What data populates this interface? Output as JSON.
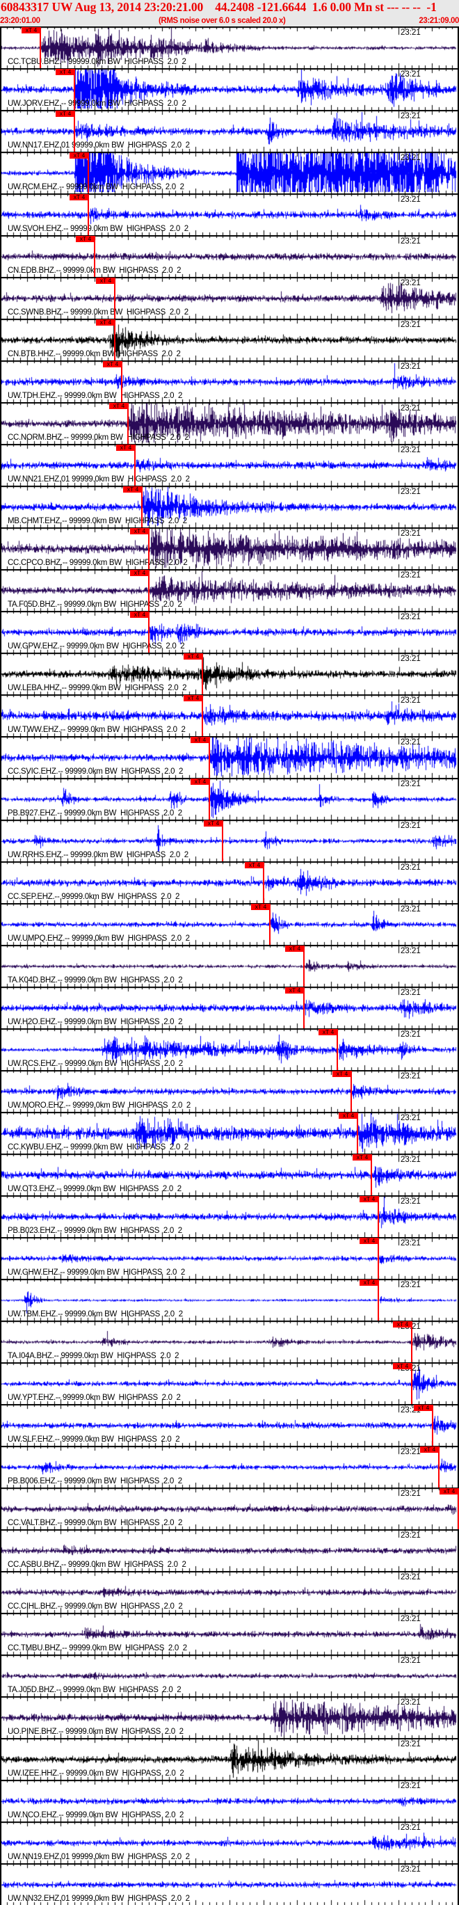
{
  "header": {
    "title": "60843317 UW Aug 13, 2014 23:20:21.00    44.2408 -121.6644  1.6 0.00 Mn st --- -- --  -1",
    "start_time": "23:20:01.00",
    "note": "(RMS noise over 6.0 s scaled 20.0 x)",
    "end_time": "23:21:09.00"
  },
  "axis": {
    "span_seconds": 68,
    "minute_label": "23:21",
    "minute_label_seconds": 59
  },
  "pick_label": "xT 4",
  "colors": {
    "ehz": "#0000ff",
    "bhz": "#2a0a58",
    "hhz": "#000000",
    "pick": "#ff0000",
    "header_text": "#ee0000",
    "header_bg": "#e8e8e8"
  },
  "traces": [
    {
      "label": "CC.TCBU.BHZ.-- 99999.0km BW  HIGHPASS  2.0  2",
      "color": "#2a0a58",
      "pick_s": 6.0
    },
    {
      "label": "UW.JORV.EHZ.-- 99999.0km BW  HIGHPASS  2.0  2",
      "color": "#0000ff",
      "pick_s": 11.0
    },
    {
      "label": "UW.NN17.EHZ.01 99999.0km BW  HIGHPASS  2.0  2",
      "color": "#0000ff",
      "pick_s": 11.0
    },
    {
      "label": "UW.RCM.EHZ.-- 99999.0km BW  HIGHPASS  2.0  2",
      "color": "#0000ff",
      "pick_s": 13.1
    },
    {
      "label": "UW.SVOH.EHZ.-- 99999.0km BW  HIGHPASS  2.0  2",
      "color": "#0000ff",
      "pick_s": 13.1
    },
    {
      "label": "CN.EDB.BHZ.-- 99999.0km BW  HIGHPASS  2.0  2",
      "color": "#2a0a58",
      "pick_s": 14.0
    },
    {
      "label": "CC.SWNB.BHZ.-- 99999.0km BW  HIGHPASS  2.0  2",
      "color": "#2a0a58",
      "pick_s": 17.0
    },
    {
      "label": "CN.BTB.HHZ.-- 99999.0km BW  HIGHPASS  2.0  2",
      "color": "#000000",
      "pick_s": 17.0
    },
    {
      "label": "UW.TDH.EHZ.-- 99999.0km BW  HIGHPASS  2.0  2",
      "color": "#0000ff",
      "pick_s": 18.0
    },
    {
      "label": "CC.NORM.BHZ.-- 99999.0km BW  HIGHPASS  2.0  2",
      "color": "#2a0a58",
      "pick_s": 19.0
    },
    {
      "label": "UW.NN21.EHZ.01 99999.0km BW  HIGHPASS  2.0  2",
      "color": "#0000ff",
      "pick_s": 20.0
    },
    {
      "label": "MB.CHMT.EHZ.-- 99999.0km BW  HIGHPASS  2.0  2",
      "color": "#0000ff",
      "pick_s": 21.0
    },
    {
      "label": "CC.CPCO.BHZ.-- 99999.0km BW  HIGHPASS  2.0  2",
      "color": "#2a0a58",
      "pick_s": 22.0
    },
    {
      "label": "TA.F05D.BHZ.-- 99999.0km BW  HIGHPASS  2.0  2",
      "color": "#2a0a58",
      "pick_s": 22.0
    },
    {
      "label": "UW.GPW.EHZ.-- 99999.0km BW  HIGHPASS  2.0  2",
      "color": "#0000ff",
      "pick_s": 22.0
    },
    {
      "label": "UW.LEBA.HHZ.-- 99999.0km BW  HIGHPASS  2.0  2",
      "color": "#000000",
      "pick_s": 30.0
    },
    {
      "label": "UW.TWW.EHZ.-- 99999.0km BW  HIGHPASS  2.0  2",
      "color": "#0000ff",
      "pick_s": 30.0
    },
    {
      "label": "CC.SVIC.EHZ.-- 99999.0km BW  HIGHPASS  2.0  2",
      "color": "#0000ff",
      "pick_s": 31.0
    },
    {
      "label": "PB.B927.EHZ.-- 99999.0km BW  HIGHPASS  2.0  2",
      "color": "#0000ff",
      "pick_s": 31.0
    },
    {
      "label": "UW.RRHS.EHZ.-- 99999.0km BW  HIGHPASS  2.0  2",
      "color": "#0000ff",
      "pick_s": 33.0
    },
    {
      "label": "CC.SEP.EHZ.-- 99999.0km BW  HIGHPASS  2.0  2",
      "color": "#0000ff",
      "pick_s": 39.0
    },
    {
      "label": "UW.UMPQ.EHZ.-- 99999.0km BW  HIGHPASS  2.0  2",
      "color": "#0000ff",
      "pick_s": 40.0
    },
    {
      "label": "TA.K04D.BHZ.-- 99999.0km BW  HIGHPASS  2.0  2",
      "color": "#2a0a58",
      "pick_s": 45.0
    },
    {
      "label": "UW.H2O.EHZ.-- 99999.0km BW  HIGHPASS  2.0  2",
      "color": "#0000ff",
      "pick_s": 45.0
    },
    {
      "label": "UW.RCS.EHZ.-- 99999.0km BW  HIGHPASS  2.0  2",
      "color": "#0000ff",
      "pick_s": 50.0
    },
    {
      "label": "UW.MORO.EHZ.-- 99999.0km BW  HIGHPASS  2.0  2",
      "color": "#0000ff",
      "pick_s": 52.0
    },
    {
      "label": "CC.KWBU.EHZ.-- 99999.0km BW  HIGHPASS  2.0  2",
      "color": "#0000ff",
      "pick_s": 53.0
    },
    {
      "label": "UW.OT3.EHZ.-- 99999.0km BW  HIGHPASS  2.0  2",
      "color": "#0000ff",
      "pick_s": 55.0
    },
    {
      "label": "PB.B023.EHZ.-- 99999.0km BW  HIGHPASS  2.0  2",
      "color": "#0000ff",
      "pick_s": 56.0
    },
    {
      "label": "UW.GHW.EHZ.-- 99999.0km BW  HIGHPASS  2.0  2",
      "color": "#0000ff",
      "pick_s": 56.0
    },
    {
      "label": "UW.TBM.EHZ.-- 99999.0km BW  HIGHPASS  2.0  2",
      "color": "#0000ff",
      "pick_s": 56.0
    },
    {
      "label": "TA.I04A.BHZ.-- 99999.0km BW  HIGHPASS  2.0  2",
      "color": "#2a0a58",
      "pick_s": 61.0
    },
    {
      "label": "UW.YPT.EHZ.-- 99999.0km BW  HIGHPASS  2.0  2",
      "color": "#0000ff",
      "pick_s": 61.0
    },
    {
      "label": "UW.SLF.EHZ.-- 99999.0km BW  HIGHPASS  2.0  2",
      "color": "#0000ff",
      "pick_s": 64.1
    },
    {
      "label": "PB.B006.EHZ.-- 99999.0km BW  HIGHPASS  2.0  2",
      "color": "#0000ff",
      "pick_s": 65.0
    },
    {
      "label": "CC.VALT.BHZ.-- 99999.0km BW  HIGHPASS  2.0  2",
      "color": "#2a0a58",
      "pick_s": 67.9
    },
    {
      "label": "CC.ASBU.BHZ.-- 99999.0km BW  HIGHPASS  2.0  2",
      "color": "#2a0a58",
      "pick_s": null
    },
    {
      "label": "CC.CIHL.BHZ.-- 99999.0km BW  HIGHPASS  2.0  2",
      "color": "#2a0a58",
      "pick_s": null
    },
    {
      "label": "CC.TMBU.BHZ.-- 99999.0km BW  HIGHPASS  2.0  2",
      "color": "#2a0a58",
      "pick_s": null
    },
    {
      "label": "TA.J05D.BHZ.-- 99999.0km BW  HIGHPASS  2.0  2",
      "color": "#2a0a58",
      "pick_s": null
    },
    {
      "label": "UO.PINE.BHZ.-- 99999.0km BW  HIGHPASS  2.0  2",
      "color": "#2a0a58",
      "pick_s": null
    },
    {
      "label": "UW.IZEE.HHZ.-- 99999.0km BW  HIGHPASS  2.0  2",
      "color": "#000000",
      "pick_s": null
    },
    {
      "label": "UW.NCO.EHZ.-- 99999.0km BW  HIGHPASS  2.0  2",
      "color": "#0000ff",
      "pick_s": null
    },
    {
      "label": "UW.NN19.EHZ.01 99999.0km BW  HIGHPASS  2.0  2",
      "color": "#0000ff",
      "pick_s": null
    },
    {
      "label": "UW.NN32.EHZ.01 99999.0km BW  HIGHPASS  2.0  2",
      "color": "#0000ff",
      "pick_s": null
    }
  ]
}
